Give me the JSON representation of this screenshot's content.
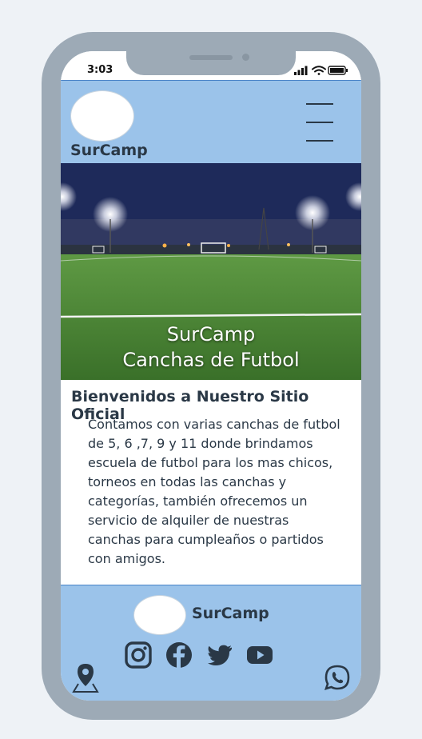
{
  "status": {
    "time": "3:03"
  },
  "header": {
    "brand": "SurCamp"
  },
  "hero": {
    "title_line1": "SurCamp",
    "title_line2": "Canchas de Futbol"
  },
  "main": {
    "heading": "Bienvenidos a Nuestro Sitio Oficial",
    "paragraph_lines": [
      "Contamos con varias canchas de futbol",
      "de 5, 6 ,7, 9 y 11 donde brindamos",
      "escuela de futbol para los mas chicos,",
      "torneos en todas las canchas y",
      "categorías, también ofrecemos un",
      "servicio de alquiler de nuestras",
      "canchas para cumpleaños o partidos",
      "con amigos."
    ]
  },
  "footer": {
    "brand": "SurCamp",
    "social_icons": [
      "instagram-icon",
      "facebook-icon",
      "twitter-icon",
      "youtube-icon"
    ],
    "location_icon": "map-pin-icon",
    "whatsapp_icon": "whatsapp-icon"
  },
  "colors": {
    "header_bg": "#9bc3ea",
    "text": "#2a3846",
    "phone_frame": "#9daab6"
  }
}
